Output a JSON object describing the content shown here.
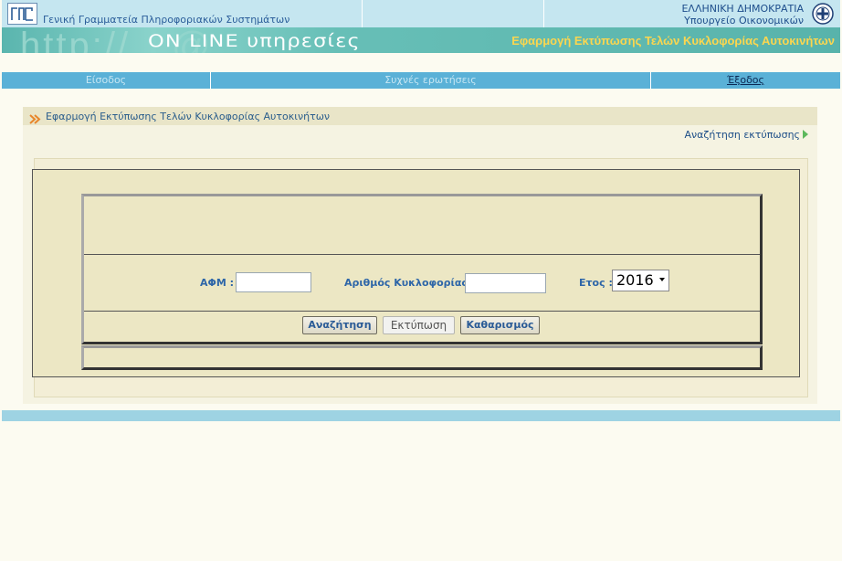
{
  "header": {
    "org_name": "Γενική Γραμματεία Πληροφοριακών Συστημάτων",
    "republic": "ΕΛΛΗΝΙΚΗ ΔΗΜΟΚΡΑΤΙΑ",
    "ministry": "Υπουργείο Οικονομικών",
    "logo_text": "ΓΓΠΣ"
  },
  "banner": {
    "http_text": "http://",
    "online_text": "ΟΝ LINE υπηρεσίες",
    "app_title": "Εφαρμογή Εκτύπωσης Τελών Κυκλοφορίας Αυτοκινήτων"
  },
  "nav": {
    "login": "Είσοδος",
    "faq": "Συχνές ερωτήσεις",
    "logout": "Έξοδος"
  },
  "section": {
    "title": "Εφαρμογή Εκτύπωσης Τελών Κυκλοφορίας Αυτοκινήτων",
    "search_link": "Αναζήτηση εκτύπωσης"
  },
  "form": {
    "afm_label": "ΑΦΜ :",
    "afm_value": "",
    "plate_label": "Αριθμός Κυκλοφορίας :",
    "plate_value": "",
    "year_label": "Ετος :",
    "year_value": "2016"
  },
  "buttons": {
    "search": "Αναζήτηση",
    "print": "Εκτύπωση",
    "clear": "Καθαρισμός"
  },
  "colors": {
    "nav_bar": "#5ab1d7",
    "banner": "#5ab5ae",
    "title_yellow": "#fbd64f",
    "label_blue": "#2e66a8"
  }
}
